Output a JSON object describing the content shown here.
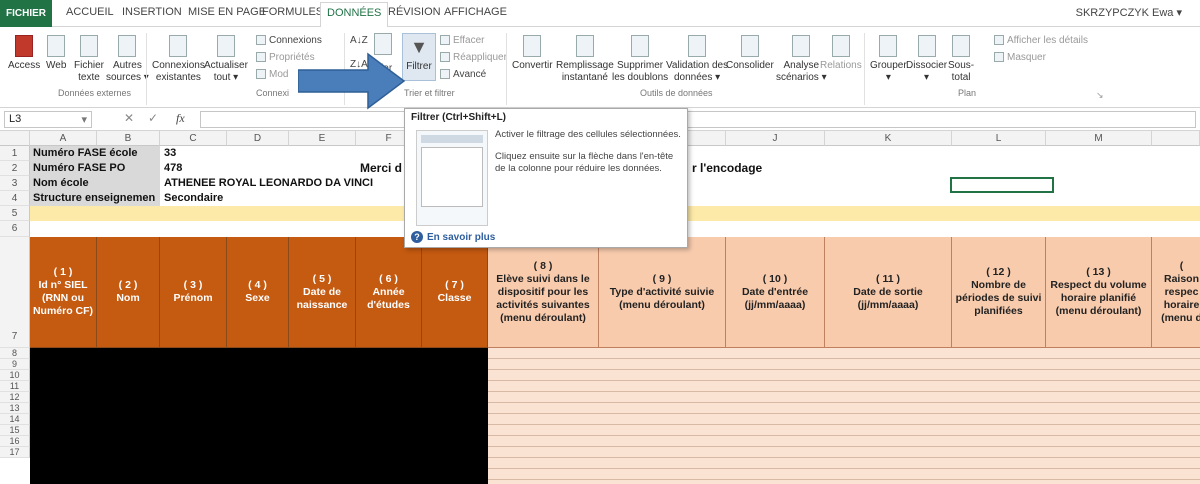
{
  "tabs": [
    "FICHIER",
    "ACCUEIL",
    "INSERTION",
    "MISE EN PAGE",
    "FORMULES",
    "DONNÉES",
    "RÉVISION",
    "AFFICHAGE"
  ],
  "user": "SKRZYPCZYK Ewa",
  "ribbon": {
    "access": "Access",
    "web": "Web",
    "fichier_texte_1": "Fichier",
    "fichier_texte_2": "texte",
    "autres_sources_1": "Autres",
    "autres_sources_2": "sources",
    "connexions_existantes_1": "Connexions",
    "connexions_existantes_2": "existantes",
    "actualiser_1": "Actualiser",
    "actualiser_2": "tout",
    "connexions": "Connexions",
    "proprietes": "Propriétés",
    "modifier": "Mod",
    "trier": "Trier",
    "filtrer": "Filtrer",
    "effacer": "Effacer",
    "reappliquer": "Réappliquer",
    "avance": "Avancé",
    "convertir": "Convertir",
    "remplissage_1": "Remplissage",
    "remplissage_2": "instantané",
    "supprimer_1": "Supprimer",
    "supprimer_2": "les doublons",
    "validation_1": "Validation des",
    "validation_2": "données",
    "consolider": "Consolider",
    "analyse_1": "Analyse",
    "analyse_2": "scénarios",
    "relations": "Relations",
    "grouper": "Grouper",
    "dissocier": "Dissocier",
    "sous_total_1": "Sous-",
    "sous_total_2": "total",
    "afficher_details": "Afficher les détails",
    "masquer": "Masquer",
    "groups": {
      "donnees_externes": "Données externes",
      "connexions": "Connexi",
      "trier_filtrer": "Trier et filtrer",
      "outils": "Outils de données",
      "plan": "Plan"
    }
  },
  "formula_bar": {
    "name_box": "L3",
    "fx": "fx"
  },
  "columns": [
    "A",
    "B",
    "C",
    "D",
    "E",
    "F",
    "G",
    "H",
    "I",
    "J",
    "K",
    "L",
    "M"
  ],
  "rows": [
    "1",
    "2",
    "3",
    "4",
    "5",
    "6",
    "7",
    "8",
    "9",
    "10",
    "11",
    "12",
    "13",
    "14",
    "15",
    "16",
    "17"
  ],
  "info": {
    "r1_label": "Numéro FASE école",
    "r1_value": "33",
    "r2_label": "Numéro FASE PO",
    "r2_value": "478",
    "r3_label": "Nom école",
    "r3_value": "ATHENEE ROYAL LEONARDO DA VINCI",
    "r4_label": "Structure enseignemen",
    "r4_value": "Secondaire",
    "merci": "Merci d",
    "encodage": "r l'encodage"
  },
  "headers": [
    "( 1 )\nId n° SIEL (RNN ou Numéro CF)",
    "( 2 )\nNom",
    "( 3 )\nPrénom",
    "( 4 )\nSexe",
    "( 5 )\nDate de naissance",
    "( 6 )\nAnnée d'études",
    "( 7 )\nClasse",
    "( 8 )\nElève suivi dans le dispositif pour les activités suivantes (menu déroulant)",
    "( 9 )\nType d'activité suivie (menu déroulant)",
    "( 10 )\nDate d'entrée (jj/mm/aaaa)",
    "( 11 )\nDate de sortie (jj/mm/aaaa)",
    "( 12 )\nNombre de périodes de suivi planifiées",
    "( 13 )\nRespect du volume horaire planifié (menu déroulant)",
    "(\nRaison respec horaire (menu d"
  ],
  "tooltip": {
    "title": "Filtrer (Ctrl+Shift+L)",
    "line1": "Activer le filtrage des cellules sélectionnées.",
    "line2": "Cliquez ensuite sur la flèche dans l'en-tête de la colonne pour réduire les données.",
    "help": "En savoir plus"
  },
  "colors": {
    "accent": "#217346",
    "header_dark": "#c55a11",
    "header_light": "#f8cbad",
    "band": "#fde9a8",
    "arrow": "#4a7ebb"
  }
}
